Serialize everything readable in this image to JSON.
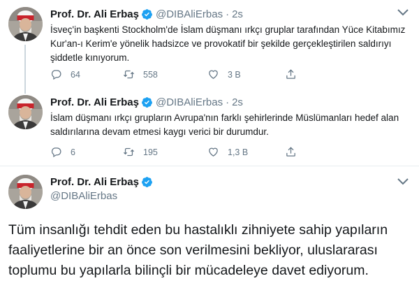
{
  "colors": {
    "verified": "#1da1f2",
    "muted": "#657786",
    "divider": "#e6ecf0"
  },
  "tweets": [
    {
      "name": "Prof. Dr. Ali Erbaş",
      "handle": "@DIBAliErbas",
      "separator": "·",
      "time": "2s",
      "text": "İsveç'in başkenti Stockholm'de İslam düşmanı ırkçı gruplar tarafından Yüce Kitabımız Kur'an-ı Kerim'e yönelik hadsizce ve provokatif bir şekilde gerçekleştirilen saldırıyı şiddetle kınıyorum.",
      "replies": "64",
      "retweets": "558",
      "likes": "3 B"
    },
    {
      "name": "Prof. Dr. Ali Erbaş",
      "handle": "@DIBAliErbas",
      "separator": "·",
      "time": "2s",
      "text": "İslam düşmanı ırkçı grupların Avrupa'nın farklı şehirlerinde Müslümanları hedef alan saldırılarına devam etmesi kaygı verici bir durumdur.",
      "replies": "6",
      "retweets": "195",
      "likes": "1,3 B"
    },
    {
      "name": "Prof. Dr. Ali Erbaş",
      "handle": "@DIBAliErbas",
      "text": "Tüm insanlığı tehdit eden bu hastalıklı zihniyete sahip yapıların faaliyetlerine bir an önce son verilmesini bekliyor, uluslararası toplumu bu yapılarla bilinçli bir mücadeleye davet ediyorum."
    }
  ]
}
